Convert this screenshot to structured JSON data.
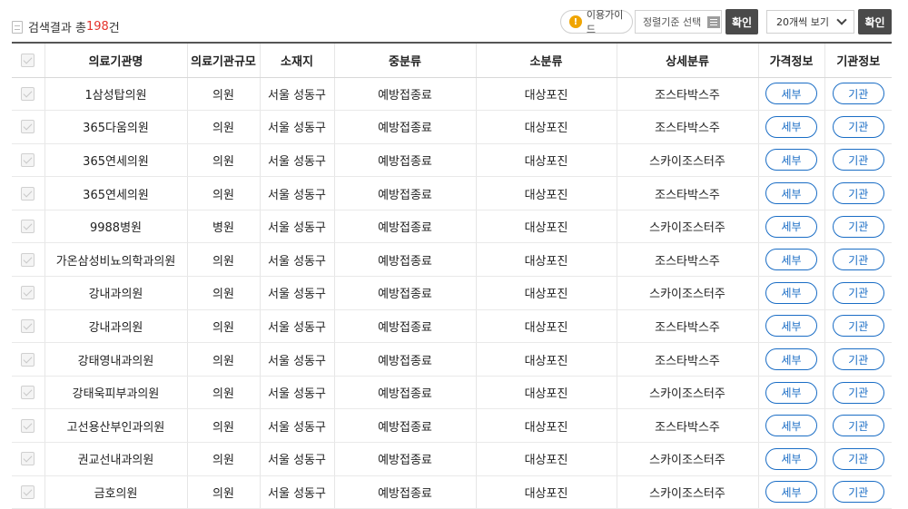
{
  "header": {
    "result_prefix": "검색결과 총",
    "result_count": "198",
    "result_suffix": "건",
    "guide_icon_glyph": "!",
    "guide_label": "이용가이드",
    "sort_label": "정렬기준 선택",
    "confirm_label": "확인",
    "page_size_selected": "20개씩 보기",
    "confirm2_label": "확인"
  },
  "colors": {
    "accent_blue": "#1a6dc5",
    "count_red": "#e4322b",
    "dark_button": "#4a4a4a",
    "guide_icon": "#f0a500"
  },
  "table": {
    "columns": [
      "",
      "의료기관명",
      "의료기관규모",
      "소재지",
      "중분류",
      "소분류",
      "상세분류",
      "가격정보",
      "기관정보"
    ],
    "detail_button_label": "세부",
    "agency_button_label": "기관",
    "rows": [
      {
        "name": "1삼성탑의원",
        "size": "의원",
        "location": "서울 성동구",
        "mid": "예방접종료",
        "small": "대상포진",
        "detail": "조스타박스주"
      },
      {
        "name": "365다움의원",
        "size": "의원",
        "location": "서울 성동구",
        "mid": "예방접종료",
        "small": "대상포진",
        "detail": "조스타박스주"
      },
      {
        "name": "365연세의원",
        "size": "의원",
        "location": "서울 성동구",
        "mid": "예방접종료",
        "small": "대상포진",
        "detail": "스카이조스터주"
      },
      {
        "name": "365연세의원",
        "size": "의원",
        "location": "서울 성동구",
        "mid": "예방접종료",
        "small": "대상포진",
        "detail": "조스타박스주"
      },
      {
        "name": "9988병원",
        "size": "병원",
        "location": "서울 성동구",
        "mid": "예방접종료",
        "small": "대상포진",
        "detail": "스카이조스터주"
      },
      {
        "name": "가온삼성비뇨의학과의원",
        "size": "의원",
        "location": "서울 성동구",
        "mid": "예방접종료",
        "small": "대상포진",
        "detail": "조스타박스주"
      },
      {
        "name": "강내과의원",
        "size": "의원",
        "location": "서울 성동구",
        "mid": "예방접종료",
        "small": "대상포진",
        "detail": "스카이조스터주"
      },
      {
        "name": "강내과의원",
        "size": "의원",
        "location": "서울 성동구",
        "mid": "예방접종료",
        "small": "대상포진",
        "detail": "조스타박스주"
      },
      {
        "name": "강태영내과의원",
        "size": "의원",
        "location": "서울 성동구",
        "mid": "예방접종료",
        "small": "대상포진",
        "detail": "조스타박스주"
      },
      {
        "name": "강태욱피부과의원",
        "size": "의원",
        "location": "서울 성동구",
        "mid": "예방접종료",
        "small": "대상포진",
        "detail": "스카이조스터주"
      },
      {
        "name": "고선용산부인과의원",
        "size": "의원",
        "location": "서울 성동구",
        "mid": "예방접종료",
        "small": "대상포진",
        "detail": "조스타박스주"
      },
      {
        "name": "권교선내과의원",
        "size": "의원",
        "location": "서울 성동구",
        "mid": "예방접종료",
        "small": "대상포진",
        "detail": "스카이조스터주"
      },
      {
        "name": "금호의원",
        "size": "의원",
        "location": "서울 성동구",
        "mid": "예방접종료",
        "small": "대상포진",
        "detail": "스카이조스터주"
      }
    ]
  }
}
